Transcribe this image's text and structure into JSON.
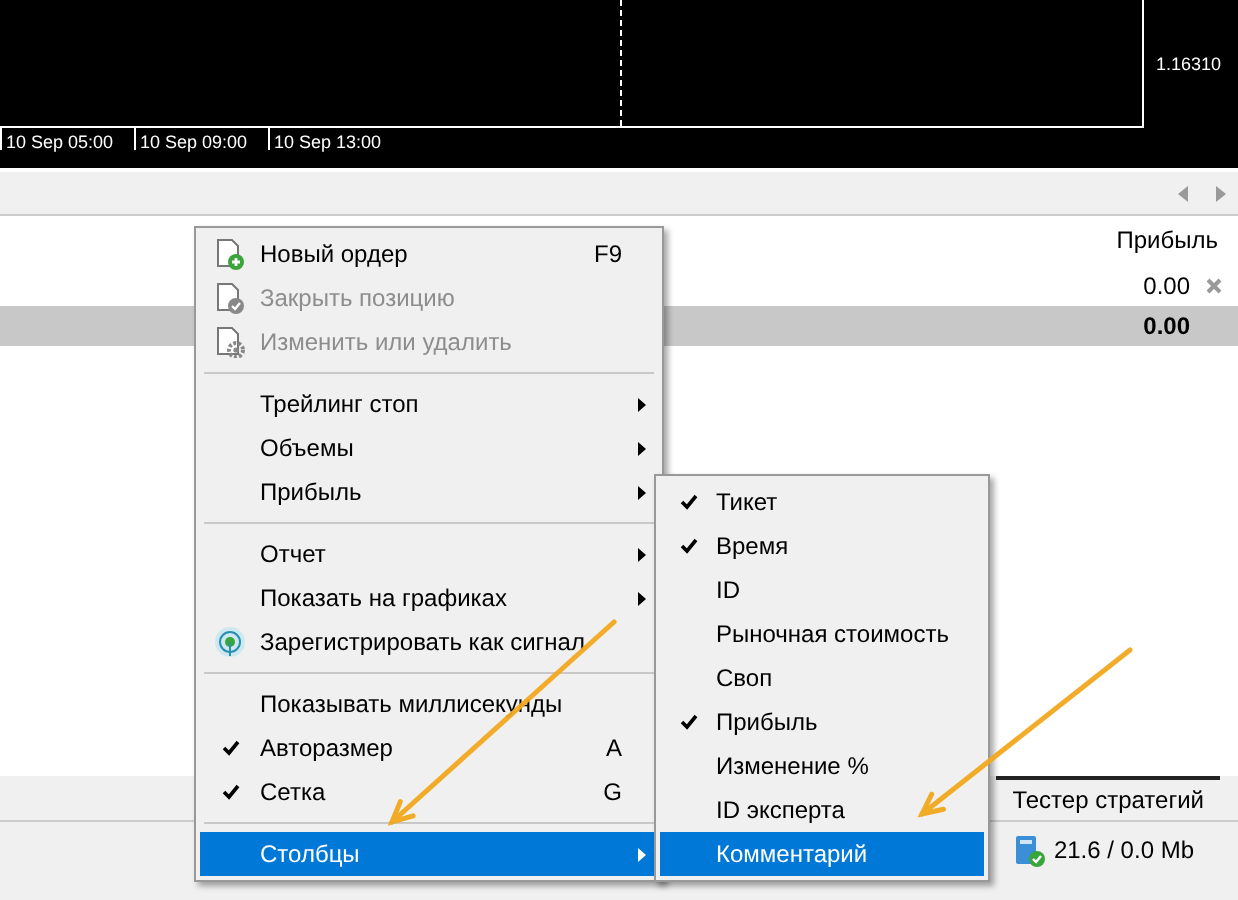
{
  "chart": {
    "price_labels": [
      "1.16310"
    ],
    "time_labels": [
      "10 Sep 05:00",
      "10 Sep 09:00",
      "10 Sep 13:00"
    ]
  },
  "table": {
    "columns": [
      {
        "label": "Прибыль"
      }
    ],
    "rows": [
      {
        "cells": [
          "0.00"
        ],
        "close_icon": true
      }
    ],
    "summary": {
      "cells": [
        "0.00"
      ]
    }
  },
  "bottom_tabs": [
    {
      "label": "Тестер стратегий",
      "selected": false
    }
  ],
  "status_bar": {
    "memory": "21.6 / 0.0 Mb"
  },
  "context_menu": {
    "items": [
      {
        "kind": "action",
        "label": "Новый ордер",
        "shortcut": "F9",
        "disabled": false,
        "checked": false,
        "selected": false
      },
      {
        "kind": "action",
        "label": "Закрыть позицию",
        "disabled": true,
        "checked": false,
        "selected": false
      },
      {
        "kind": "action",
        "label": "Изменить или удалить",
        "disabled": true,
        "checked": false,
        "selected": false
      },
      {
        "kind": "separator"
      },
      {
        "kind": "submenu",
        "label": "Трейлинг стоп",
        "disabled": false,
        "checked": false,
        "selected": false
      },
      {
        "kind": "submenu",
        "label": "Объемы",
        "disabled": false,
        "checked": false,
        "selected": false
      },
      {
        "kind": "submenu",
        "label": "Прибыль",
        "disabled": false,
        "checked": false,
        "selected": false
      },
      {
        "kind": "separator"
      },
      {
        "kind": "submenu",
        "label": "Отчет",
        "disabled": false,
        "checked": false,
        "selected": false
      },
      {
        "kind": "submenu",
        "label": "Показать на графиках",
        "disabled": false,
        "checked": false,
        "selected": false
      },
      {
        "kind": "action",
        "label": "Зарегистрировать как сигнал",
        "disabled": false,
        "checked": false,
        "selected": false
      },
      {
        "kind": "separator"
      },
      {
        "kind": "action",
        "label": "Показывать миллисекунды",
        "disabled": false,
        "checked": false,
        "selected": false
      },
      {
        "kind": "action",
        "label": "Авторазмер",
        "shortcut": "A",
        "disabled": false,
        "checked": true,
        "selected": false
      },
      {
        "kind": "action",
        "label": "Сетка",
        "shortcut": "G",
        "disabled": false,
        "checked": true,
        "selected": false
      },
      {
        "kind": "separator"
      },
      {
        "kind": "submenu",
        "label": "Столбцы",
        "disabled": false,
        "checked": false,
        "selected": true
      }
    ]
  },
  "submenu": {
    "items": [
      {
        "label": "Тикет",
        "checked": true,
        "selected": false
      },
      {
        "label": "Время",
        "checked": true,
        "selected": false
      },
      {
        "label": "ID",
        "checked": false,
        "selected": false
      },
      {
        "label": "Рыночная стоимость",
        "checked": false,
        "selected": false
      },
      {
        "label": "Своп",
        "checked": false,
        "selected": false
      },
      {
        "label": "Прибыль",
        "checked": true,
        "selected": false
      },
      {
        "label": "Изменение %",
        "checked": false,
        "selected": false
      },
      {
        "label": "ID эксперта",
        "checked": false,
        "selected": false
      },
      {
        "label": "Комментарий",
        "checked": false,
        "selected": true
      }
    ]
  }
}
